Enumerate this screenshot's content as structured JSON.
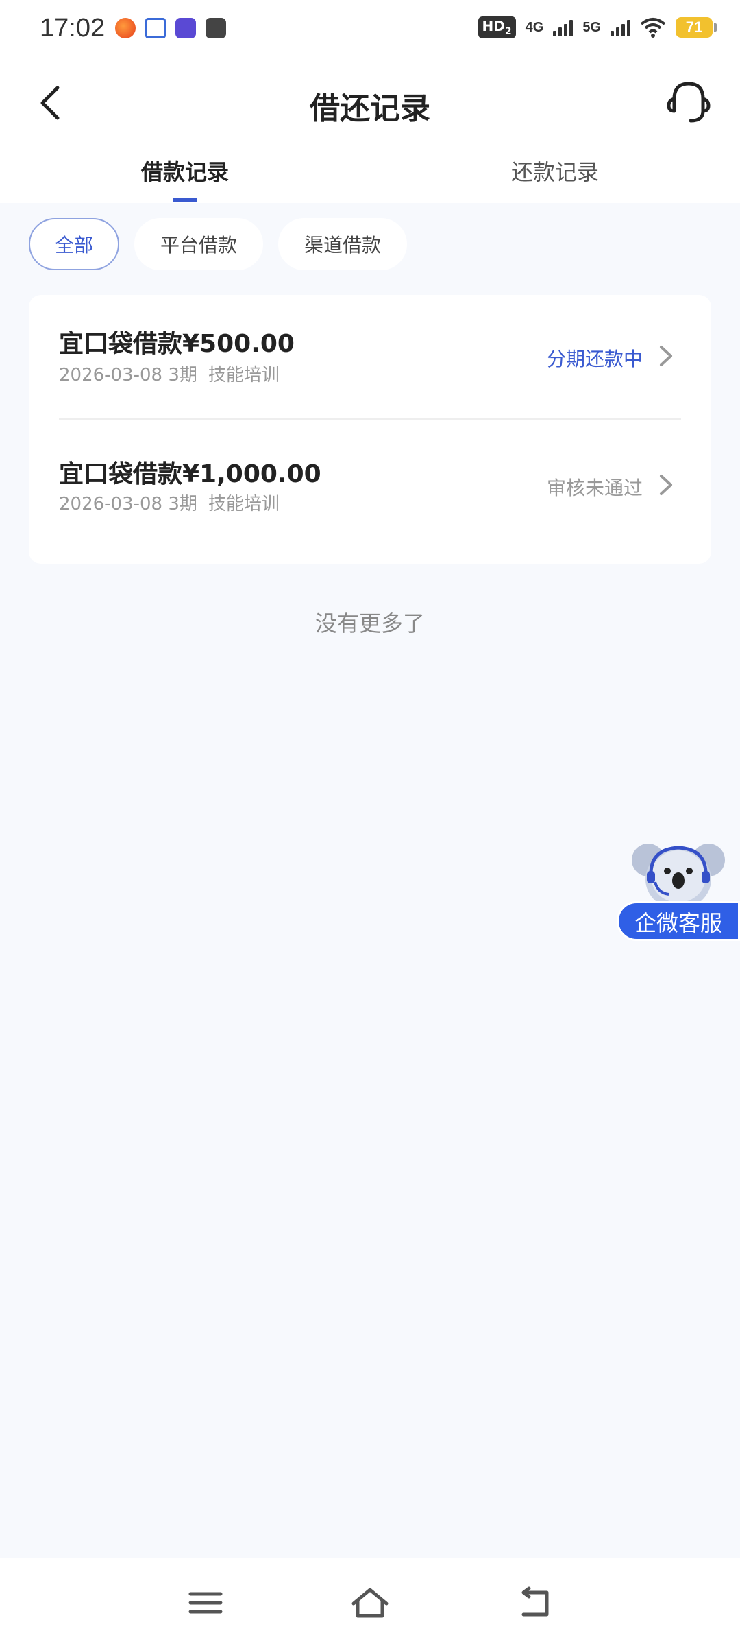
{
  "status_bar": {
    "time": "17:02",
    "hd": "HD",
    "hd_sub": "2",
    "net1": "4G",
    "net2": "5G",
    "battery": "71",
    "notification_icons": [
      "weibo-icon",
      "email-icon",
      "tieba-icon",
      "vivo-icon"
    ]
  },
  "header": {
    "title": "借还记录",
    "back_icon": "chevron-left-icon",
    "support_icon": "headset-icon"
  },
  "tabs": [
    {
      "label": "借款记录",
      "active": true
    },
    {
      "label": "还款记录",
      "active": false
    }
  ],
  "filters": [
    {
      "label": "全部",
      "active": true
    },
    {
      "label": "平台借款",
      "active": false
    },
    {
      "label": "渠道借款",
      "active": false
    }
  ],
  "loans": [
    {
      "title": "宜口袋借款¥500.00",
      "date": "2026-03-08",
      "term": "3期",
      "purpose": "技能培训",
      "status": "分期还款中",
      "status_color": "#3a5ad0"
    },
    {
      "title": "宜口袋借款¥1,000.00",
      "date": "2026-03-08",
      "term": "3期",
      "purpose": "技能培训",
      "status": "审核未通过",
      "status_color": "#999999"
    }
  ],
  "end_text": "没有更多了",
  "float_service": {
    "label": "企微客服",
    "icon": "koala-agent-icon"
  },
  "colors": {
    "accent": "#3a5ad0",
    "float_button": "#2f5fe6",
    "background": "#f7f9fd"
  },
  "nav_bar": {
    "icons": [
      "menu-icon",
      "home-icon",
      "back-icon"
    ]
  }
}
